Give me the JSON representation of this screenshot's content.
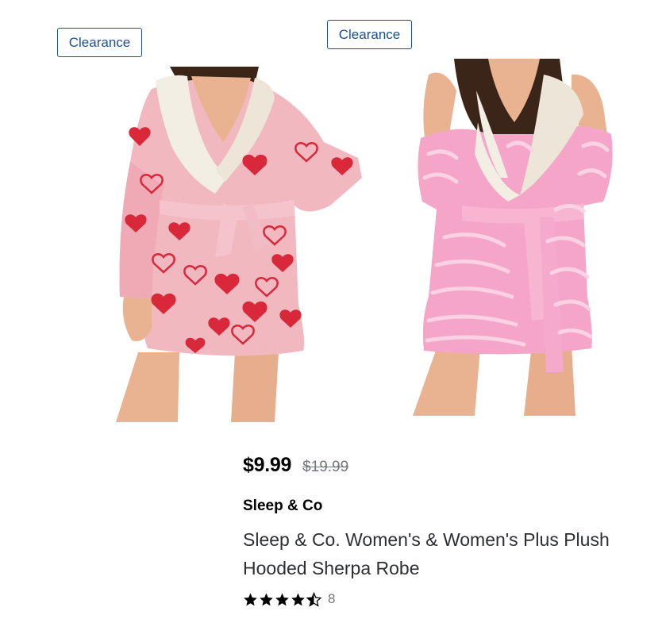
{
  "products": [
    {
      "badge": "Clearance",
      "image_description_icon": "pink-heart-robe-photo",
      "colors": {
        "robe": "#f2b8c0",
        "pattern": "#d8283a",
        "collar": "#f3eee4"
      }
    },
    {
      "badge": "Clearance",
      "image_description_icon": "pink-zebra-robe-photo",
      "colors": {
        "robe": "#f5a6c8",
        "pattern": "#fbd2e3",
        "collar": "#f3eee4"
      }
    }
  ],
  "details": {
    "price_current": "$9.99",
    "price_was": "$19.99",
    "brand": "Sleep & Co",
    "title": "Sleep & Co. Women's & Women's Plus Plush Hooded Sherpa Robe",
    "rating_stars": 4.5,
    "review_count": "8"
  },
  "theme": {
    "badge_color": "#1d4f91",
    "text_dark": "#000000",
    "text_muted": "#74767c"
  }
}
